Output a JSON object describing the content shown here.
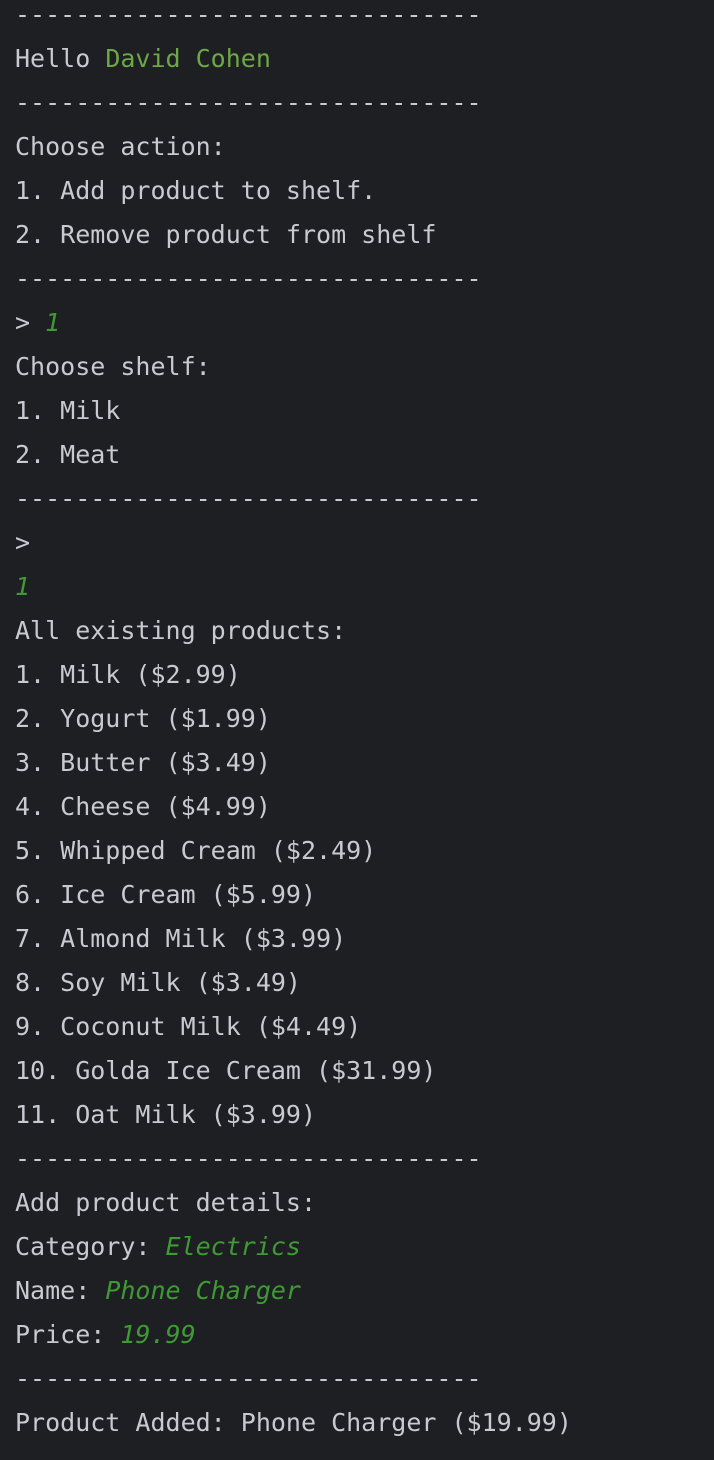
{
  "separator": "-------------------------------",
  "greeting": {
    "prefix": "Hello ",
    "user_name": "David Cohen"
  },
  "action_menu": {
    "prompt": "Choose action:",
    "options": [
      "1. Add product to shelf.",
      "2. Remove product from shelf"
    ]
  },
  "action_input": {
    "prompt": "> ",
    "value": "1"
  },
  "shelf_menu": {
    "prompt": "Choose shelf:",
    "options": [
      "1. Milk",
      "2. Meat"
    ]
  },
  "shelf_input": {
    "prompt": ">",
    "value": "1"
  },
  "products": {
    "heading": "All existing products:",
    "items": [
      "1. Milk ($2.99)",
      "2. Yogurt ($1.99)",
      "3. Butter ($3.49)",
      "4. Cheese ($4.99)",
      "5. Whipped Cream ($2.49)",
      "6. Ice Cream ($5.99)",
      "7. Almond Milk ($3.99)",
      "8. Soy Milk ($3.49)",
      "9. Coconut Milk ($4.49)",
      "10. Golda Ice Cream ($31.99)",
      "11. Oat Milk ($3.99)"
    ]
  },
  "product_details": {
    "heading": "Add product details:",
    "category_label": "Category: ",
    "category_value": "Electrics",
    "name_label": "Name: ",
    "name_value": "Phone Charger",
    "price_label": "Price: ",
    "price_value": "19.99"
  },
  "result": "Product Added: Phone Charger ($19.99)",
  "colors": {
    "background": "#1e1f22",
    "text": "#c7cad0",
    "user_name": "#6ca843",
    "user_input": "#3e9b34"
  }
}
